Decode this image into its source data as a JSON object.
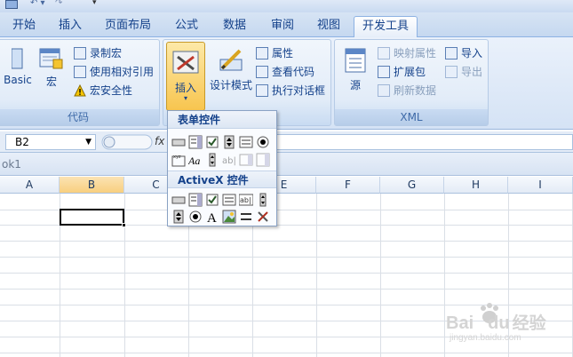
{
  "tabs": [
    "开始",
    "插入",
    "页面布局",
    "公式",
    "数据",
    "审阅",
    "视图",
    "开发工具"
  ],
  "active_tab": "开发工具",
  "ribbon": {
    "code_group": {
      "caption": "代码",
      "visual_basic_label": "Basic",
      "macros_label": "宏",
      "record_macro": "录制宏",
      "relative_ref": "使用相对引用",
      "macro_security": "宏安全性"
    },
    "controls_group": {
      "insert_label": "插入",
      "design_mode_label": "设计模式",
      "properties": "属性",
      "view_code": "查看代码",
      "run_dialog": "执行对话框"
    },
    "xml_group": {
      "caption": "XML",
      "source_label": "源",
      "map_props": "映射属性",
      "expansion_packs": "扩展包",
      "refresh_data": "刷新数据",
      "import": "导入",
      "export": "导出"
    }
  },
  "name_box": "B2",
  "fx_label": "fx",
  "workbook_title": "ok1",
  "columns": [
    "A",
    "B",
    "C",
    "D",
    "E",
    "F",
    "G",
    "H",
    "I"
  ],
  "selected_cell": "B2",
  "insert_dropdown": {
    "form_controls_header": "表单控件",
    "activex_header": "ActiveX 控件",
    "form_controls_icons": [
      "button-icon",
      "combo-box-icon",
      "checkbox-icon",
      "spinner-icon",
      "list-box-icon",
      "option-button-icon",
      "group-box-icon",
      "label-icon",
      "scroll-bar-icon",
      "text-field-icon",
      "combo-list-icon",
      "combo-dropdown-icon"
    ],
    "activex_icons": [
      "command-button-icon",
      "combo-box-icon",
      "checkbox-icon",
      "list-box-icon",
      "text-box-icon",
      "scroll-bar-icon",
      "spin-button-icon",
      "option-button-icon",
      "label-icon",
      "image-icon",
      "toggle-button-icon",
      "more-controls-icon"
    ]
  },
  "watermark": {
    "brand": "Bai",
    "brand2": "du",
    "cn": "经验",
    "url": "jingyan.baidu.com"
  },
  "colors": {
    "tab_text": "#15428b",
    "selected_col_header": "#f8cf7f",
    "ribbon_bg": "#dde8f6"
  }
}
